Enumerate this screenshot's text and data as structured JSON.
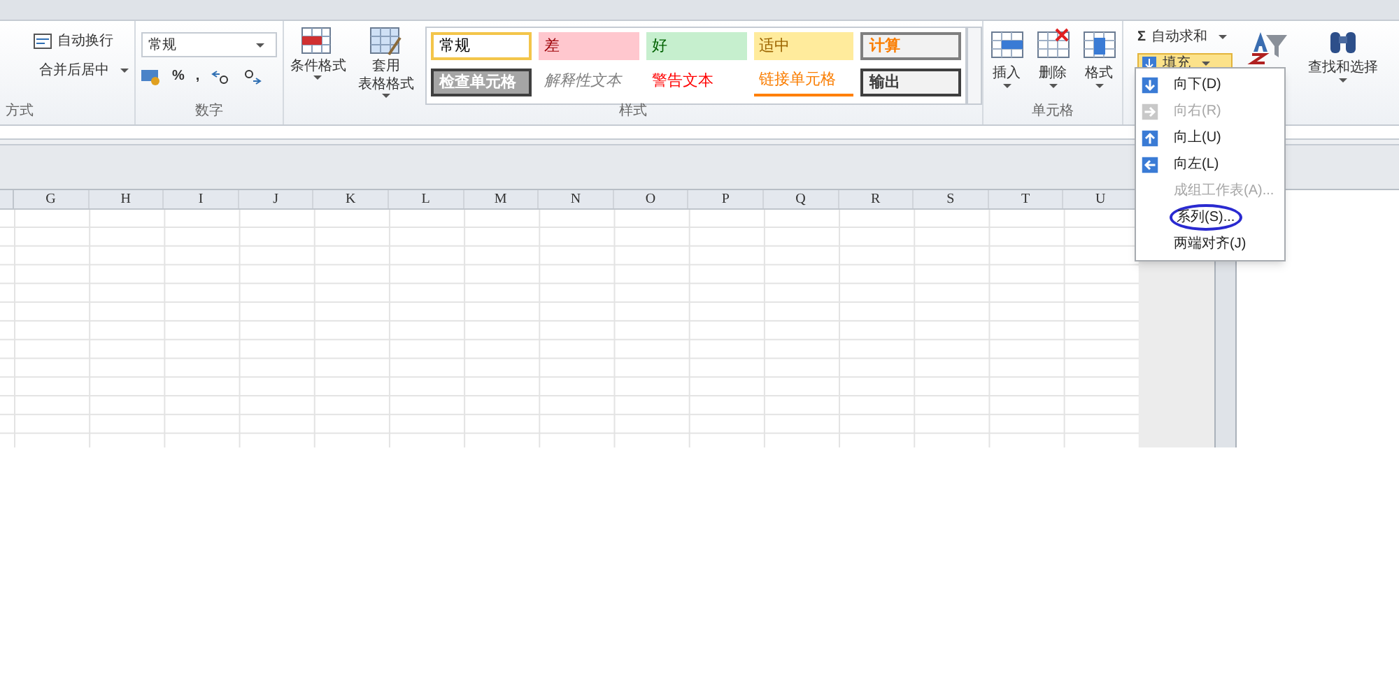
{
  "ribbon": {
    "alignment_group": {
      "label": "方式",
      "buttons": [
        {
          "label": "自动换行",
          "has_dropdown": false
        },
        {
          "label": "合并后居中",
          "has_dropdown": true
        }
      ]
    },
    "number_group": {
      "label": "数字",
      "format_field": {
        "value": "常规"
      },
      "buttons": [
        "%",
        ","
      ]
    },
    "styles_group": {
      "label": "样式",
      "buttons": [
        {
          "label": "条件格式"
        },
        {
          "label": "套用",
          "sublabel": "表格格式"
        }
      ],
      "cell_styles": [
        {
          "label": "常规",
          "kind": "normal"
        },
        {
          "label": "差",
          "kind": "bad"
        },
        {
          "label": "好",
          "kind": "good"
        },
        {
          "label": "适中",
          "kind": "neutral"
        },
        {
          "label": "计算",
          "kind": "calc"
        },
        {
          "label": "检查单元格",
          "kind": "check"
        },
        {
          "label": "解释性文本",
          "kind": "explain"
        },
        {
          "label": "警告文本",
          "kind": "warn"
        },
        {
          "label": "链接单元格",
          "kind": "link"
        },
        {
          "label": "输出",
          "kind": "output"
        }
      ]
    },
    "cells_group": {
      "label": "单元格",
      "buttons": [
        {
          "label": "插入",
          "kind": "insert"
        },
        {
          "label": "删除",
          "kind": "delete"
        },
        {
          "label": "格式",
          "kind": "format"
        }
      ]
    },
    "editing_group": {
      "autosum_icon": "Σ",
      "autosum": "自动求和",
      "fill": {
        "label": "填充",
        "expanded": true
      },
      "find": "查找和选择"
    }
  },
  "fill_menu": {
    "items": [
      {
        "label": "向下(D)",
        "kind": "down",
        "disabled": false,
        "circled": false
      },
      {
        "label": "向右(R)",
        "kind": "right",
        "disabled": true,
        "circled": false
      },
      {
        "label": "向上(U)",
        "kind": "up",
        "disabled": false,
        "circled": false
      },
      {
        "label": "向左(L)",
        "kind": "left",
        "disabled": false,
        "circled": false
      },
      {
        "label": "成组工作表(A)...",
        "kind": "none",
        "disabled": true,
        "circled": false
      },
      {
        "label": "系列(S)...",
        "kind": "none",
        "disabled": false,
        "circled": true
      },
      {
        "label": "两端对齐(J)",
        "kind": "none",
        "disabled": false,
        "circled": false
      }
    ]
  },
  "sheet": {
    "columns": [
      "G",
      "H",
      "I",
      "J",
      "K",
      "L",
      "M",
      "N",
      "O",
      "P",
      "Q",
      "R",
      "S",
      "T",
      "U"
    ]
  }
}
